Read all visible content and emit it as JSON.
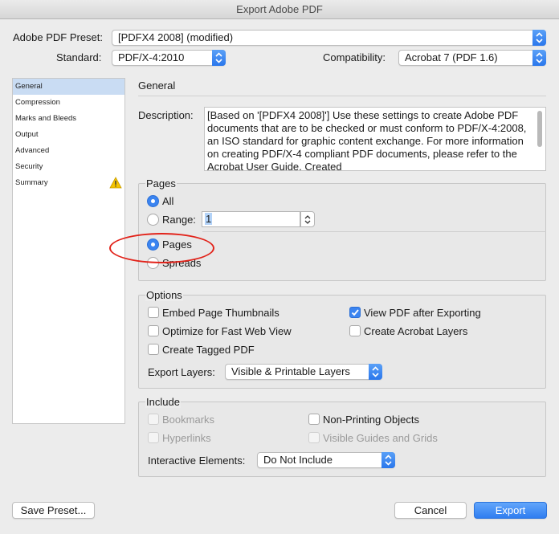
{
  "window": {
    "title": "Export Adobe PDF"
  },
  "preset": {
    "label": "Adobe PDF Preset:",
    "value": "[PDFX4 2008] (modified)"
  },
  "standard": {
    "label": "Standard:",
    "value": "PDF/X-4:2010"
  },
  "compatibility": {
    "label": "Compatibility:",
    "value": "Acrobat 7 (PDF 1.6)"
  },
  "sidebar": {
    "items": [
      {
        "label": "General",
        "selected": true
      },
      {
        "label": "Compression"
      },
      {
        "label": "Marks and Bleeds"
      },
      {
        "label": "Output"
      },
      {
        "label": "Advanced"
      },
      {
        "label": "Security"
      },
      {
        "label": "Summary",
        "icon": "warning-icon"
      }
    ]
  },
  "main": {
    "title": "General",
    "description_label": "Description:",
    "description": "[Based on '[PDFX4 2008]'] Use these settings to create Adobe PDF documents that are to be checked or must conform to PDF/X-4:2008, an ISO standard for graphic content exchange.  For more information on creating PDF/X-4 compliant PDF documents, please refer to the Acrobat User Guide.  Created"
  },
  "pages": {
    "title": "Pages",
    "all_label": "All",
    "all_selected": true,
    "range_label": "Range:",
    "range_value": "1",
    "pages_label": "Pages",
    "pages_selected": true,
    "spreads_label": "Spreads"
  },
  "options": {
    "title": "Options",
    "embed_thumbnails": {
      "label": "Embed Page Thumbnails",
      "checked": false
    },
    "optimize_web": {
      "label": "Optimize for Fast Web View",
      "checked": false
    },
    "tagged_pdf": {
      "label": "Create Tagged PDF",
      "checked": false
    },
    "view_after": {
      "label": "View PDF after Exporting",
      "checked": true
    },
    "acrobat_layers": {
      "label": "Create Acrobat Layers",
      "checked": false
    },
    "export_layers_label": "Export Layers:",
    "export_layers_value": "Visible & Printable Layers"
  },
  "include": {
    "title": "Include",
    "bookmarks": {
      "label": "Bookmarks",
      "enabled": false
    },
    "hyperlinks": {
      "label": "Hyperlinks",
      "enabled": false
    },
    "non_printing": {
      "label": "Non-Printing Objects",
      "checked": false
    },
    "visible_guides": {
      "label": "Visible Guides and Grids",
      "enabled": false
    },
    "interactive_label": "Interactive Elements:",
    "interactive_value": "Do Not Include"
  },
  "footer": {
    "save_preset": "Save Preset...",
    "cancel": "Cancel",
    "export": "Export"
  },
  "colors": {
    "accent": "#3b84f0",
    "annotation": "#e2231a",
    "warning": "#f5c400"
  }
}
